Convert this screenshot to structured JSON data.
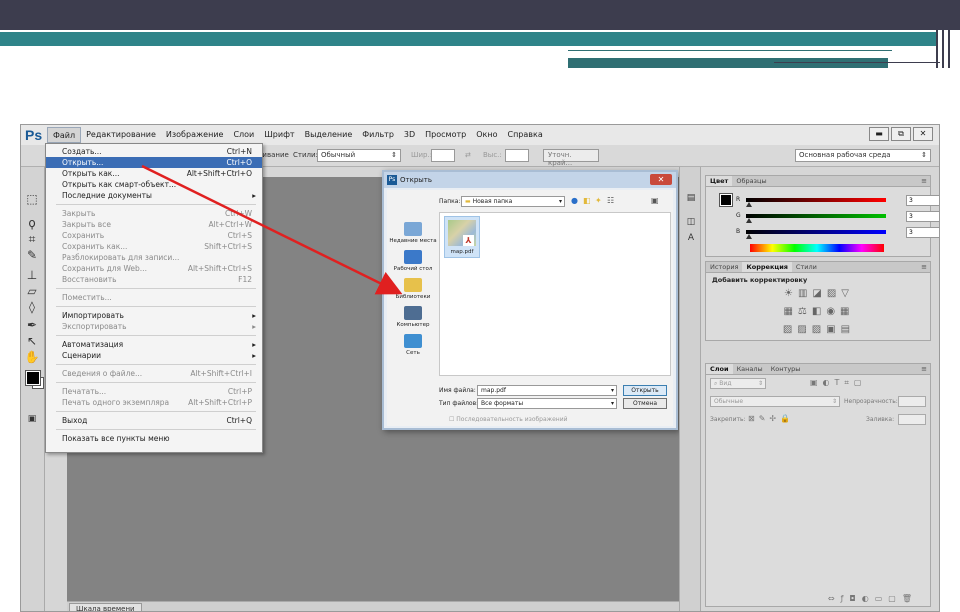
{
  "app": {
    "logo": "Ps",
    "menu": [
      "Файл",
      "Редактирование",
      "Изображение",
      "Слои",
      "Шрифт",
      "Выделение",
      "Фильтр",
      "3D",
      "Просмотр",
      "Окно",
      "Справка"
    ],
    "window_buttons": [
      "▬",
      "⧉",
      "✕"
    ]
  },
  "options_bar": {
    "partial_label": "равнивание",
    "styles_label": "Стили:",
    "styles_value": "Обычный",
    "width_label": "Шир.:",
    "height_label": "Выс.:",
    "refine_button": "Уточн. край...",
    "workspace": "Основная рабочая среда"
  },
  "file_menu": [
    {
      "label": "Создать...",
      "shortcut": "Ctrl+N",
      "disabled": false
    },
    {
      "label": "Открыть...",
      "shortcut": "Ctrl+O",
      "disabled": false,
      "highlighted": true
    },
    {
      "label": "Открыть как...",
      "shortcut": "Alt+Shift+Ctrl+O",
      "disabled": false
    },
    {
      "label": "Открыть как смарт-объект...",
      "shortcut": "",
      "disabled": false
    },
    {
      "label": "Последние документы",
      "shortcut": "",
      "disabled": false,
      "submenu": true
    },
    {
      "label": "Закрыть",
      "shortcut": "Ctrl+W",
      "disabled": true
    },
    {
      "label": "Закрыть все",
      "shortcut": "Alt+Ctrl+W",
      "disabled": true
    },
    {
      "label": "Сохранить",
      "shortcut": "Ctrl+S",
      "disabled": true
    },
    {
      "label": "Сохранить как...",
      "shortcut": "Shift+Ctrl+S",
      "disabled": true
    },
    {
      "label": "Разблокировать для записи...",
      "shortcut": "",
      "disabled": true
    },
    {
      "label": "Сохранить для Web...",
      "shortcut": "Alt+Shift+Ctrl+S",
      "disabled": true
    },
    {
      "label": "Восстановить",
      "shortcut": "F12",
      "disabled": true
    },
    {
      "label": "Поместить...",
      "shortcut": "",
      "disabled": true
    },
    {
      "label": "Импортировать",
      "shortcut": "",
      "disabled": false,
      "submenu": true
    },
    {
      "label": "Экспортировать",
      "shortcut": "",
      "disabled": true,
      "submenu": true
    },
    {
      "label": "Автоматизация",
      "shortcut": "",
      "disabled": false,
      "submenu": true
    },
    {
      "label": "Сценарии",
      "shortcut": "",
      "disabled": false,
      "submenu": true
    },
    {
      "label": "Сведения о файле...",
      "shortcut": "Alt+Shift+Ctrl+I",
      "disabled": true
    },
    {
      "label": "Печатать...",
      "shortcut": "Ctrl+P",
      "disabled": true
    },
    {
      "label": "Печать одного экземпляра",
      "shortcut": "Alt+Shift+Ctrl+P",
      "disabled": true
    },
    {
      "label": "Выход",
      "shortcut": "Ctrl+Q",
      "disabled": false
    },
    {
      "label": "Показать все пункты меню",
      "shortcut": "",
      "disabled": false
    }
  ],
  "open_dialog": {
    "title": "Открыть",
    "folder_label": "Папка:",
    "folder_value": "Новая папка",
    "places": [
      "Недавние места",
      "Рабочий стол",
      "Библиотеки",
      "Компьютер",
      "Сеть"
    ],
    "file": "map.pdf",
    "filename_label": "Имя файла:",
    "filename_value": "map.pdf",
    "filetype_label": "Тип файлов:",
    "filetype_value": "Все форматы",
    "open_button": "Открыть",
    "cancel_button": "Отмена",
    "sequence_checkbox": "Последовательность изображений"
  },
  "color_panel": {
    "tabs": [
      "Цвет",
      "Образцы"
    ],
    "channels": [
      {
        "label": "R",
        "value": "3"
      },
      {
        "label": "G",
        "value": "3"
      },
      {
        "label": "B",
        "value": "3"
      }
    ]
  },
  "adjust_panel": {
    "tabs": [
      "История",
      "Коррекция",
      "Стили"
    ],
    "title": "Добавить корректировку"
  },
  "layers_panel": {
    "tabs": [
      "Слои",
      "Каналы",
      "Контуры"
    ],
    "kind_label": "Вид",
    "blend_mode": "Обычные",
    "opacity_label": "Непрозрачность:",
    "lock_label": "Закрепить:",
    "fill_label": "Заливка:"
  },
  "timeline_tab": "Шкала времени",
  "colors": {
    "highlight": "#3b6db5",
    "arrow": "#e02020",
    "slide_dark": "#3d3d4e",
    "slide_teal": "#2f8489"
  }
}
